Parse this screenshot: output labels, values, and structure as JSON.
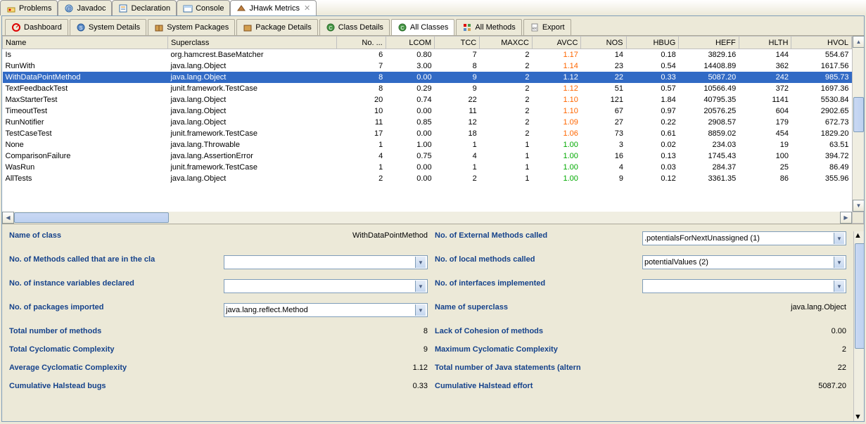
{
  "eclipseTabs": [
    {
      "label": "Problems",
      "icon": "problems"
    },
    {
      "label": "Javadoc",
      "icon": "javadoc"
    },
    {
      "label": "Declaration",
      "icon": "declaration"
    },
    {
      "label": "Console",
      "icon": "console"
    },
    {
      "label": "JHawk Metrics",
      "icon": "jhawk",
      "active": true
    }
  ],
  "innerTabs": [
    {
      "label": "Dashboard",
      "icon": "dashboard"
    },
    {
      "label": "System Details",
      "icon": "system"
    },
    {
      "label": "System Packages",
      "icon": "packages"
    },
    {
      "label": "Package Details",
      "icon": "pkg"
    },
    {
      "label": "Class Details",
      "icon": "class"
    },
    {
      "label": "All Classes",
      "icon": "allclass",
      "active": true
    },
    {
      "label": "All Methods",
      "icon": "methods"
    },
    {
      "label": "Export",
      "icon": "export"
    }
  ],
  "columns": [
    "Name",
    "Superclass",
    "No. ...",
    "LCOM",
    "TCC",
    "MAXCC",
    "AVCC",
    "NOS",
    "HBUG",
    "HEFF",
    "HLTH",
    "HVOL"
  ],
  "rows": [
    {
      "name": "Is",
      "super": "org.hamcrest.BaseMatcher",
      "no": "6",
      "lcom": "0.80",
      "tcc": "7",
      "maxcc": "2",
      "avcc": "1.17",
      "avccClass": "avcc-orange",
      "nos": "14",
      "hbug": "0.18",
      "heff": "3829.16",
      "hlth": "144",
      "hvol": "554.67"
    },
    {
      "name": "RunWith",
      "super": "java.lang.Object",
      "no": "7",
      "lcom": "3.00",
      "tcc": "8",
      "maxcc": "2",
      "avcc": "1.14",
      "avccClass": "avcc-orange",
      "nos": "23",
      "hbug": "0.54",
      "heff": "14408.89",
      "hlth": "362",
      "hvol": "1617.56"
    },
    {
      "name": "WithDataPointMethod",
      "super": "java.lang.Object",
      "no": "8",
      "lcom": "0.00",
      "tcc": "9",
      "maxcc": "2",
      "avcc": "1.12",
      "avccClass": "avcc-orange",
      "nos": "22",
      "hbug": "0.33",
      "heff": "5087.20",
      "hlth": "242",
      "hvol": "985.73",
      "selected": true
    },
    {
      "name": "TextFeedbackTest",
      "super": "junit.framework.TestCase",
      "no": "8",
      "lcom": "0.29",
      "tcc": "9",
      "maxcc": "2",
      "avcc": "1.12",
      "avccClass": "avcc-orange",
      "nos": "51",
      "hbug": "0.57",
      "heff": "10566.49",
      "hlth": "372",
      "hvol": "1697.36"
    },
    {
      "name": "MaxStarterTest",
      "super": "java.lang.Object",
      "no": "20",
      "lcom": "0.74",
      "tcc": "22",
      "maxcc": "2",
      "avcc": "1.10",
      "avccClass": "avcc-orange",
      "nos": "121",
      "hbug": "1.84",
      "heff": "40795.35",
      "hlth": "1141",
      "hvol": "5530.84"
    },
    {
      "name": "TimeoutTest",
      "super": "java.lang.Object",
      "no": "10",
      "lcom": "0.00",
      "tcc": "11",
      "maxcc": "2",
      "avcc": "1.10",
      "avccClass": "avcc-orange",
      "nos": "67",
      "hbug": "0.97",
      "heff": "20576.25",
      "hlth": "604",
      "hvol": "2902.65"
    },
    {
      "name": "RunNotifier",
      "super": "java.lang.Object",
      "no": "11",
      "lcom": "0.85",
      "tcc": "12",
      "maxcc": "2",
      "avcc": "1.09",
      "avccClass": "avcc-orange",
      "nos": "27",
      "hbug": "0.22",
      "heff": "2908.57",
      "hlth": "179",
      "hvol": "672.73"
    },
    {
      "name": "TestCaseTest",
      "super": "junit.framework.TestCase",
      "no": "17",
      "lcom": "0.00",
      "tcc": "18",
      "maxcc": "2",
      "avcc": "1.06",
      "avccClass": "avcc-orange",
      "nos": "73",
      "hbug": "0.61",
      "heff": "8859.02",
      "hlth": "454",
      "hvol": "1829.20"
    },
    {
      "name": "None",
      "super": "java.lang.Throwable",
      "no": "1",
      "lcom": "1.00",
      "tcc": "1",
      "maxcc": "1",
      "avcc": "1.00",
      "avccClass": "avcc-green",
      "nos": "3",
      "hbug": "0.02",
      "heff": "234.03",
      "hlth": "19",
      "hvol": "63.51"
    },
    {
      "name": "ComparisonFailure",
      "super": "java.lang.AssertionError",
      "no": "4",
      "lcom": "0.75",
      "tcc": "4",
      "maxcc": "1",
      "avcc": "1.00",
      "avccClass": "avcc-green",
      "nos": "16",
      "hbug": "0.13",
      "heff": "1745.43",
      "hlth": "100",
      "hvol": "394.72"
    },
    {
      "name": "WasRun",
      "super": "junit.framework.TestCase",
      "no": "1",
      "lcom": "0.00",
      "tcc": "1",
      "maxcc": "1",
      "avcc": "1.00",
      "avccClass": "avcc-green",
      "nos": "4",
      "hbug": "0.03",
      "heff": "284.37",
      "hlth": "25",
      "hvol": "86.49"
    },
    {
      "name": "AllTests",
      "super": "java.lang.Object",
      "no": "2",
      "lcom": "0.00",
      "tcc": "2",
      "maxcc": "1",
      "avcc": "1.00",
      "avccClass": "avcc-green",
      "nos": "9",
      "hbug": "0.12",
      "heff": "3361.35",
      "hlth": "86",
      "hvol": "355.96"
    }
  ],
  "details": {
    "nameOfClass": {
      "label": "Name of class",
      "value": "WithDataPointMethod"
    },
    "extMethods": {
      "label": "No. of External Methods called",
      "combo": ".potentialsForNextUnassigned  (1)"
    },
    "methodsInCla": {
      "label": "No. of Methods called that are in the cla",
      "combo": ""
    },
    "localMethods": {
      "label": "No. of local methods called",
      "combo": "potentialValues  (2)"
    },
    "instanceVars": {
      "label": "No. of instance variables declared",
      "combo": ""
    },
    "interfaces": {
      "label": "No. of interfaces implemented",
      "combo": ""
    },
    "packages": {
      "label": "No. of packages imported",
      "combo": "java.lang.reflect.Method"
    },
    "superclass": {
      "label": "Name of superclass",
      "value": "java.lang.Object"
    },
    "totalMethods": {
      "label": "Total number of methods",
      "value": "8"
    },
    "lackCohesion": {
      "label": "Lack of Cohesion of methods",
      "value": "0.00"
    },
    "totalCyclo": {
      "label": "Total Cyclomatic Complexity",
      "value": "9"
    },
    "maxCyclo": {
      "label": "Maximum Cyclomatic Complexity",
      "value": "2"
    },
    "avgCyclo": {
      "label": "Average Cyclomatic Complexity",
      "value": "1.12"
    },
    "totalStmts": {
      "label": "Total number of Java statements (altern",
      "value": "22"
    },
    "cumBugs": {
      "label": "Cumulative Halstead bugs",
      "value": "0.33"
    },
    "cumEffort": {
      "label": "Cumulative Halstead effort",
      "value": "5087.20"
    }
  }
}
